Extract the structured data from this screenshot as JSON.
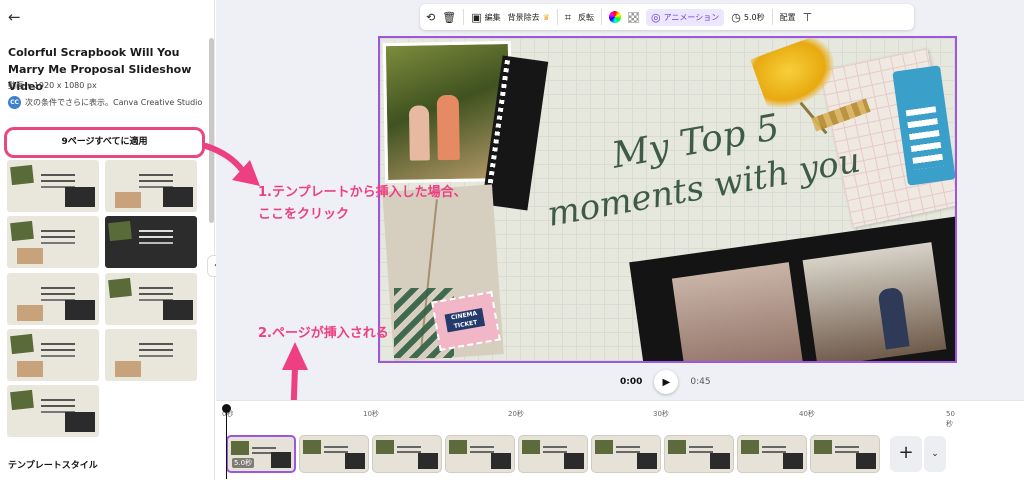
{
  "left_panel": {
    "back_icon": "arrow-left-icon",
    "title": "Colorful Scrapbook Will You Marry Me Proposal Slideshow Video",
    "meta": "動画 • 1920 x 1080 px",
    "creator_avatar": "CC",
    "creator_text": "次の条件でさらに表示。Canva Creative Studio",
    "apply_button": "9ページすべてに適用",
    "section_title": "テンプレートスタイル",
    "thumbnail_count": 9
  },
  "toolbar": {
    "edit": "編集",
    "bg_remove": "背景除去",
    "flip": "反転",
    "animation": "アニメーション",
    "duration": "5.0秒",
    "arrange": "配置"
  },
  "canvas": {
    "headline_line1": "My Top 5",
    "headline_line2": "moments with you",
    "ticket_text": "CINEMA TICKET"
  },
  "playback": {
    "current_time": "0:00",
    "total_time": "0:45"
  },
  "annotations": {
    "note1": "1.テンプレートから挿入した場合、ここをクリック",
    "note2": "2.ページが挿入される",
    "color": "#ee3f83"
  },
  "timeline": {
    "ticks": [
      "0秒",
      "10秒",
      "20秒",
      "30秒",
      "40秒",
      "50秒"
    ],
    "clip_duration_label": "5.0秒",
    "clip_count": 9
  },
  "colors": {
    "accent": "#9b57e0",
    "annotation_pink": "#ee3f83",
    "apply_border": "#e8477f"
  }
}
